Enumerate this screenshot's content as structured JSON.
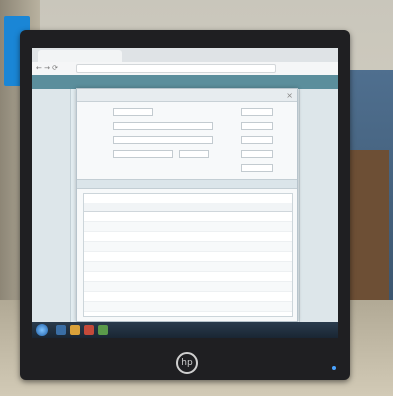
{
  "browser": {
    "tab_title": "",
    "address": "",
    "nav_glyphs": "←  →  ⟳"
  },
  "modal": {
    "title": "",
    "close_glyph": "×",
    "form": {
      "labels": [
        "",
        "",
        "",
        "",
        ""
      ],
      "values": [
        "",
        "",
        "",
        "",
        ""
      ],
      "right_labels": [
        "",
        "",
        "",
        "",
        ""
      ],
      "right_values": [
        "",
        "",
        "",
        "",
        ""
      ]
    },
    "section_title": "",
    "table": {
      "title": "",
      "headers": [
        "",
        "",
        "",
        "",
        "",
        "",
        "",
        ""
      ],
      "rows": [
        [
          "",
          "",
          "",
          "",
          "",
          "",
          "",
          ""
        ],
        [
          "",
          "",
          "",
          "",
          "",
          "",
          "",
          ""
        ],
        [
          "",
          "",
          "",
          "",
          "",
          "",
          "",
          ""
        ],
        [
          "",
          "",
          "",
          "",
          "",
          "",
          "",
          ""
        ],
        [
          "",
          "",
          "",
          "",
          "",
          "",
          "",
          ""
        ],
        [
          "",
          "",
          "",
          "",
          "",
          "",
          "",
          ""
        ],
        [
          "",
          "",
          "",
          "",
          "",
          "",
          "",
          ""
        ],
        [
          "",
          "",
          "",
          "",
          "",
          "",
          "",
          ""
        ],
        [
          "",
          "",
          "",
          "",
          "",
          "",
          "",
          ""
        ],
        [
          "",
          "",
          "",
          "",
          "",
          "",
          "",
          ""
        ]
      ]
    }
  },
  "monitor": {
    "logo": "hp"
  },
  "colors": {
    "page_nav": "#5b8e9c",
    "taskbar": "#1a2633",
    "accent": "#1a86d6"
  }
}
